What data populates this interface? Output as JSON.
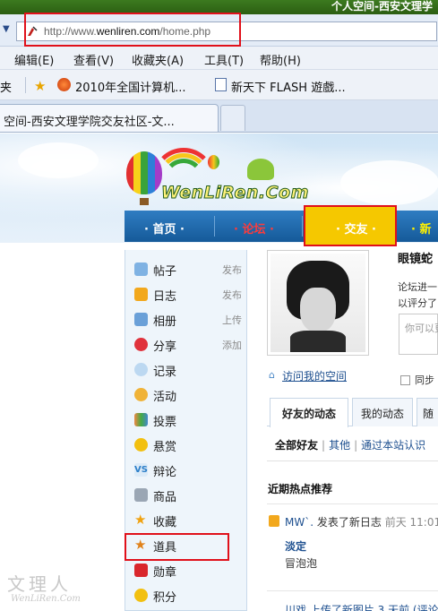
{
  "window": {
    "title": "个人空间-西安文理学"
  },
  "address": {
    "url_prefix": "http://www.",
    "url_host": "wenliren.com",
    "url_path": "/home.php"
  },
  "menu": [
    "编辑(E)",
    "查看(V)",
    "收藏夹(A)",
    "工具(T)",
    "帮助(H)"
  ],
  "favorites": {
    "folder": "夹",
    "items": [
      "2010年全国计算机...",
      "新天下 FLASH 遊戲..."
    ]
  },
  "tab": {
    "label": "空间-西安文理学院交友社区-文..."
  },
  "logo": {
    "text": "WenLiRen.Com"
  },
  "nav": {
    "items": [
      "· 首页 ·",
      "· 论坛 ·",
      "· 交友 ·",
      "· 新"
    ]
  },
  "sidebar": {
    "items": [
      {
        "label": "帖子",
        "action": "发布",
        "icon": "search-icon"
      },
      {
        "label": "日志",
        "action": "发布",
        "icon": "journal-icon"
      },
      {
        "label": "相册",
        "action": "上传",
        "icon": "photo-icon"
      },
      {
        "label": "分享",
        "action": "添加",
        "icon": "heart-icon"
      },
      {
        "label": "记录",
        "action": "",
        "icon": "chat-icon"
      },
      {
        "label": "活动",
        "action": "",
        "icon": "people-icon"
      },
      {
        "label": "投票",
        "action": "",
        "icon": "chart-icon"
      },
      {
        "label": "悬赏",
        "action": "",
        "icon": "gold-icon"
      },
      {
        "label": "辩论",
        "action": "",
        "icon": "vs-icon"
      },
      {
        "label": "商品",
        "action": "",
        "icon": "cart-icon"
      },
      {
        "label": "收藏",
        "action": "",
        "icon": "star-icon"
      },
      {
        "label": "道具",
        "action": "",
        "icon": "tool-star-icon"
      },
      {
        "label": "勋章",
        "action": "",
        "icon": "medal-icon"
      },
      {
        "label": "积分",
        "action": "",
        "icon": "coin-icon"
      }
    ]
  },
  "profile": {
    "name": "眼镜蛇",
    "desc1": "论坛进一",
    "desc2": "以评分了",
    "status_placeholder": "你可以更",
    "sync_label": "同步",
    "visit_link": "访问我的空间"
  },
  "feed": {
    "tabs": [
      "好友的动态",
      "我的动态",
      "随"
    ],
    "filters": {
      "selected": "全部好友",
      "other": "其他",
      "third": "通过本站认识"
    },
    "section_title": "近期热点推荐",
    "item1": {
      "user": "MW`.",
      "action": "发表了新日志",
      "time": "前天 11:01"
    },
    "item1_title": "淡定",
    "item1_sub": "冒泡泡",
    "item2": "川戏 上传了新图片 3 天前 (评论"
  },
  "watermark": {
    "main": "文理人",
    "sub": "WenLiRen.Com"
  },
  "colors": {
    "nav_blue": "#1a6aae",
    "active_tab": "#f5c800",
    "highlight": "#e0101a",
    "link": "#1d4f8f"
  }
}
